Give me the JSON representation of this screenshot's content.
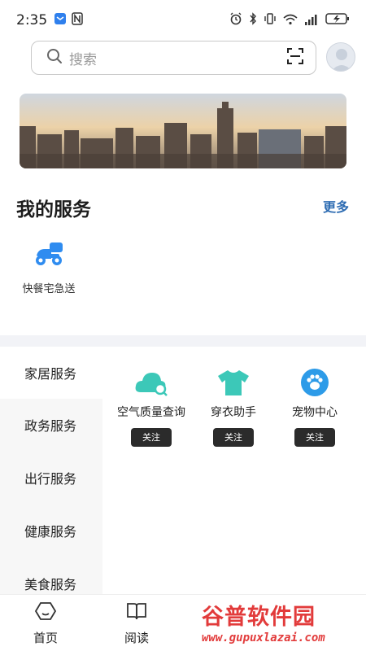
{
  "status_bar": {
    "time": "2:35",
    "left_icons": [
      "msg-badge-icon",
      "nfc-icon"
    ],
    "right_icons": [
      "alarm-icon",
      "bluetooth-icon",
      "vibrate-icon",
      "wifi-icon",
      "signal-icon",
      "battery-charging-icon"
    ]
  },
  "search": {
    "placeholder": "搜索",
    "icon": "search-icon",
    "scan_icon": "scan-icon"
  },
  "profile": {
    "icon": "avatar-icon"
  },
  "banner": {
    "image": "city-skyline-banner"
  },
  "my_services": {
    "title": "我的服务",
    "more_label": "更多",
    "items": [
      {
        "label": "快餐宅急送",
        "icon": "scooter-delivery-icon"
      }
    ]
  },
  "categories": {
    "items": [
      {
        "label": "家居服务",
        "active": true
      },
      {
        "label": "政务服务",
        "active": false
      },
      {
        "label": "出行服务",
        "active": false
      },
      {
        "label": "健康服务",
        "active": false
      },
      {
        "label": "美食服务",
        "active": false
      }
    ]
  },
  "features": [
    {
      "label": "空气质量查询",
      "button": "关注",
      "icon": "air-quality-icon"
    },
    {
      "label": "穿衣助手",
      "button": "关注",
      "icon": "tshirt-icon"
    },
    {
      "label": "宠物中心",
      "button": "关注",
      "icon": "paw-icon"
    }
  ],
  "bottom_nav": {
    "items": [
      {
        "label": "首页",
        "icon": "home-icon"
      },
      {
        "label": "阅读",
        "icon": "book-icon"
      }
    ]
  },
  "watermark": {
    "brand": "谷普软件园",
    "url": "www.gupuxlazai.com"
  },
  "colors": {
    "accent": "#2f6db3",
    "teal": "#3cc8b8",
    "paw_blue": "#2d9be8",
    "delivery_blue": "#2f8cf0",
    "button_dark": "#2b2b2b",
    "watermark_red": "#e23b3b"
  }
}
